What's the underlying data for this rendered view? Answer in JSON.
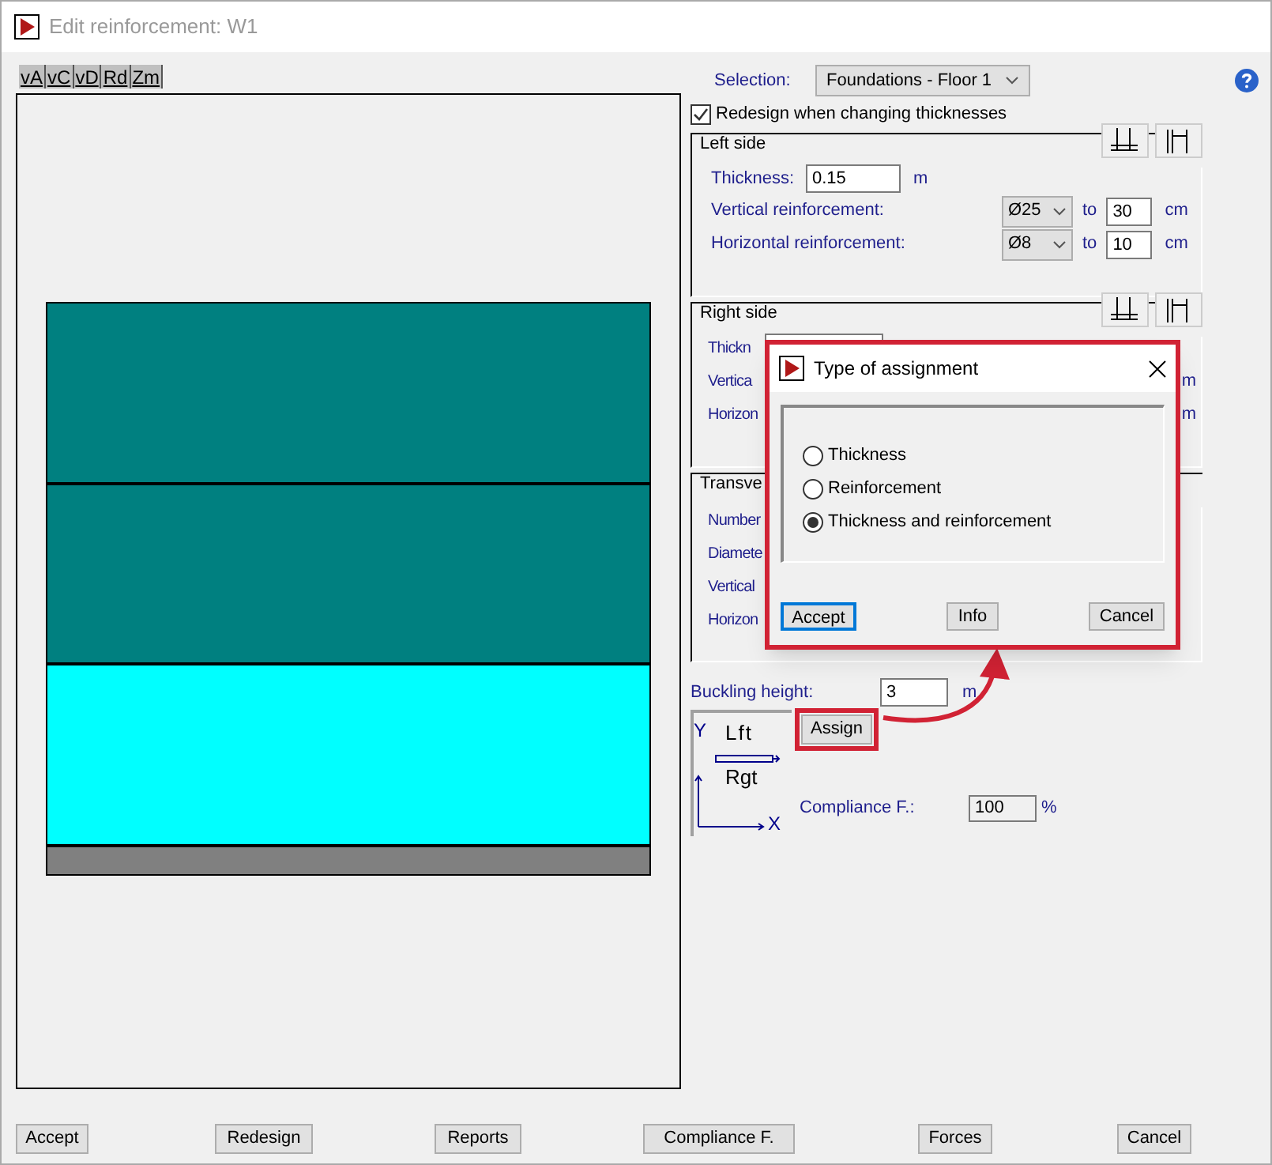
{
  "window": {
    "title": "Edit reinforcement: W1"
  },
  "view_tabs": [
    {
      "label": "vA"
    },
    {
      "label": "vC"
    },
    {
      "label": "vD"
    },
    {
      "label": "Rd"
    },
    {
      "label": "Zm"
    }
  ],
  "drawing": {
    "layers": [
      {
        "color": "#008080"
      },
      {
        "color": "#008080"
      },
      {
        "color": "#00ffff"
      },
      {
        "color": "#808080"
      }
    ]
  },
  "selection": {
    "label": "Selection:",
    "value": "Foundations - Floor 1"
  },
  "redesign_checkbox": {
    "label": "Redesign when changing thicknesses",
    "checked": true
  },
  "left_side": {
    "title": "Left side",
    "thickness_label": "Thickness:",
    "thickness": "0.15",
    "unit": "m",
    "rows": [
      {
        "label": "Vertical reinforcement:",
        "diameter": "Ø25",
        "to": "to",
        "spacing": "30",
        "unit": "cm"
      },
      {
        "label": "Horizontal reinforcement:",
        "diameter": "Ø8",
        "to": "to",
        "spacing": "10",
        "unit": "cm"
      }
    ]
  },
  "right_side": {
    "title": "Right side",
    "labels": [
      "Thickn",
      "Vertica",
      "Horizon"
    ],
    "units": [
      "m",
      "m"
    ]
  },
  "transverse": {
    "title": "Transve",
    "labels": [
      "Number",
      "Diamete",
      "Vertical",
      "Horizon"
    ]
  },
  "buckling": {
    "label": "Buckling height:",
    "value": "3",
    "unit": "m"
  },
  "assign_button": "Assign",
  "axis_diagram": {
    "y": "Y",
    "top": "Lft",
    "bottom": "Rgt",
    "x": "X"
  },
  "compliance": {
    "label": "Compliance F.:",
    "value": "100",
    "unit": "%"
  },
  "buttons": [
    "Accept",
    "Redesign",
    "Reports",
    "Compliance F.",
    "Forces",
    "Cancel"
  ],
  "dialog": {
    "title": "Type of assignment",
    "options": [
      {
        "label": "Thickness",
        "selected": false
      },
      {
        "label": "Reinforcement",
        "selected": false
      },
      {
        "label": "Thickness and reinforcement",
        "selected": true
      }
    ],
    "buttons": [
      "Accept",
      "Info",
      "Cancel"
    ]
  }
}
